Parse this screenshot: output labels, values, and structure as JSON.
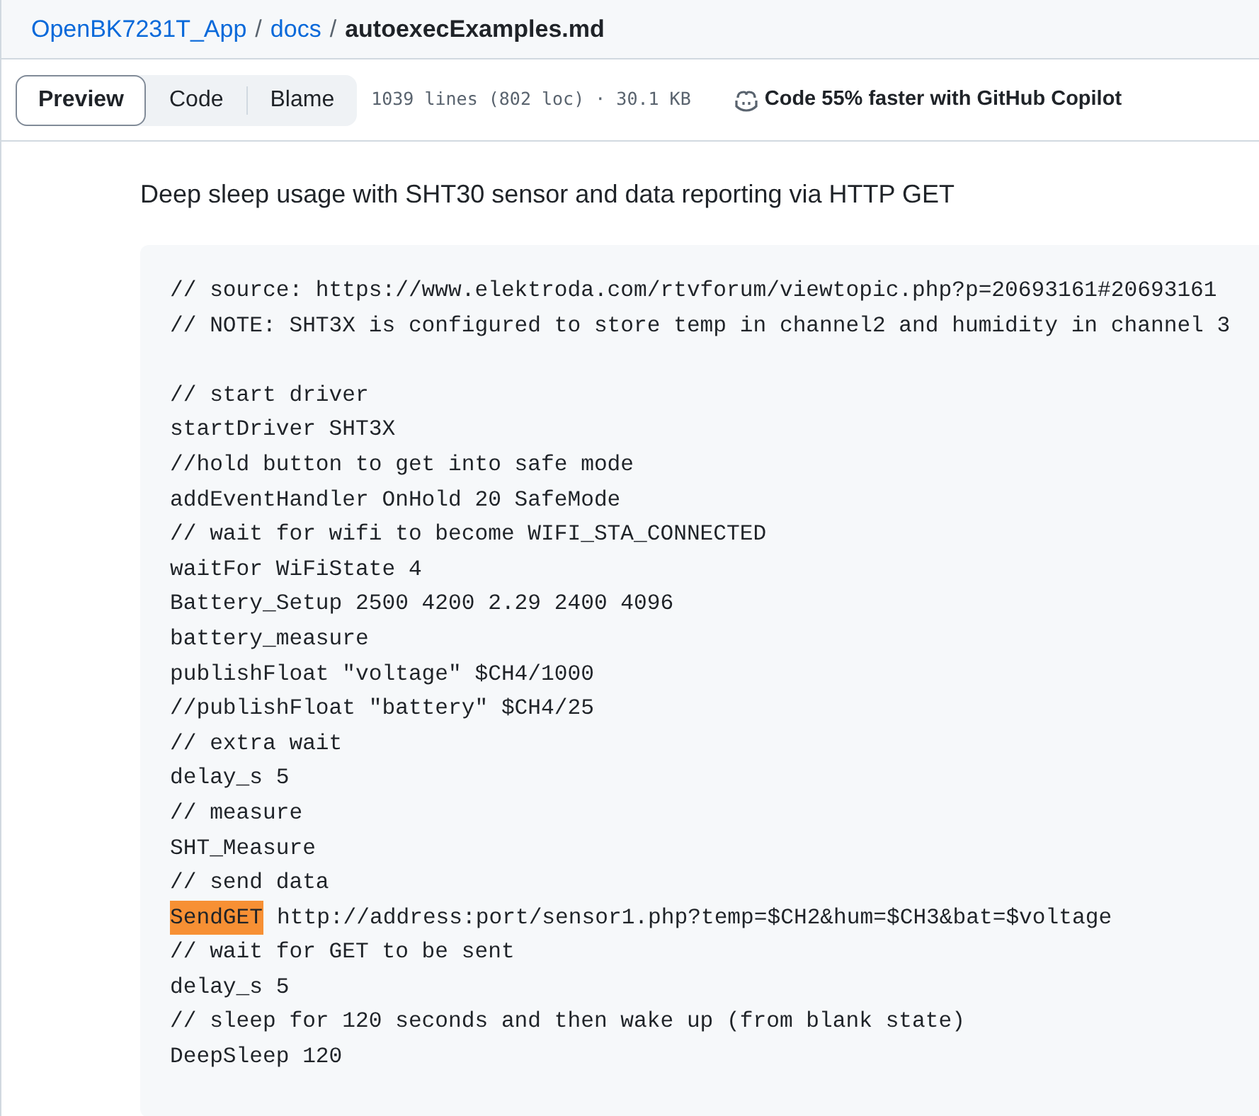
{
  "breadcrumb": [
    {
      "label": "OpenBK7231T_App",
      "kind": "link"
    },
    {
      "label": "/",
      "kind": "separator"
    },
    {
      "label": "docs",
      "kind": "link"
    },
    {
      "label": "/",
      "kind": "separator"
    },
    {
      "label": "autoexecExamples.md",
      "kind": "current"
    }
  ],
  "view_tabs": [
    {
      "label": "Preview",
      "selected": true
    },
    {
      "label": "Code",
      "selected": false
    },
    {
      "label": "Blame",
      "selected": false
    }
  ],
  "file_info": "1039 lines (802 loc) · 30.1 KB",
  "copilot_promo": "Code 55% faster with GitHub Copilot",
  "heading": "Deep sleep usage with SHT30 sensor and data reporting via HTTP GET",
  "code_lines": [
    {
      "kind": "plain",
      "text": "// source: https://www.elektroda.com/rtvforum/viewtopic.php?p=20693161#20693161"
    },
    {
      "kind": "plain",
      "text": "// NOTE: SHT3X is configured to store temp in channel2 and humidity in channel 3"
    },
    {
      "kind": "blank"
    },
    {
      "kind": "plain",
      "text": "// start driver"
    },
    {
      "kind": "plain",
      "text": "startDriver SHT3X"
    },
    {
      "kind": "plain",
      "text": "//hold button to get into safe mode"
    },
    {
      "kind": "plain",
      "text": "addEventHandler OnHold 20 SafeMode"
    },
    {
      "kind": "plain",
      "text": "// wait for wifi to become WIFI_STA_CONNECTED"
    },
    {
      "kind": "plain",
      "text": "waitFor WiFiState 4"
    },
    {
      "kind": "plain",
      "text": "Battery_Setup 2500 4200 2.29 2400 4096"
    },
    {
      "kind": "plain",
      "text": "battery_measure"
    },
    {
      "kind": "plain",
      "text": "publishFloat \"voltage\" $CH4/1000"
    },
    {
      "kind": "plain",
      "text": "//publishFloat \"battery\" $CH4/25"
    },
    {
      "kind": "plain",
      "text": "// extra wait"
    },
    {
      "kind": "plain",
      "text": "delay_s 5"
    },
    {
      "kind": "plain",
      "text": "// measure"
    },
    {
      "kind": "plain",
      "text": "SHT_Measure"
    },
    {
      "kind": "plain",
      "text": "// send data"
    },
    {
      "kind": "highlighted",
      "highlight": "SendGET",
      "text": "http://address:port/sensor1.php?temp=$CH2&hum=$CH3&bat=$voltage"
    },
    {
      "kind": "plain",
      "text": "// wait for GET to be sent"
    },
    {
      "kind": "plain",
      "text": "delay_s 5"
    },
    {
      "kind": "plain",
      "text": "// sleep for 120 seconds and then wake up (from blank state)"
    },
    {
      "kind": "plain",
      "text": "DeepSleep 120"
    }
  ]
}
